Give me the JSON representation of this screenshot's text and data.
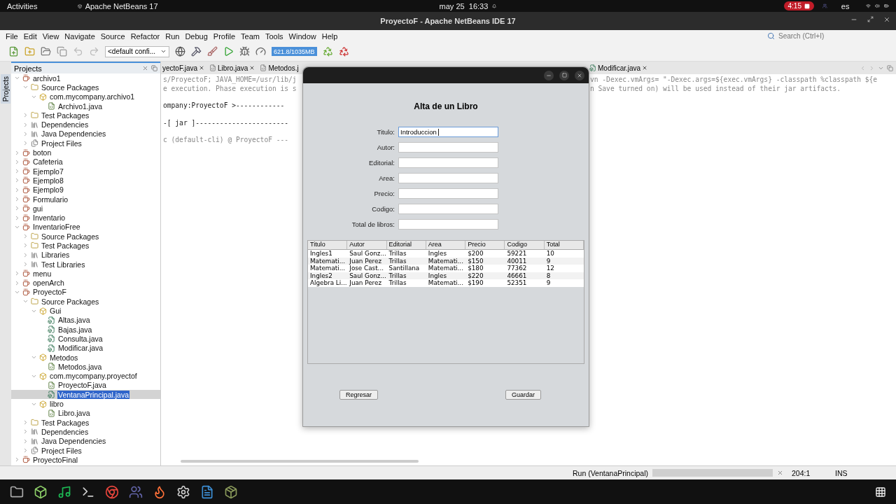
{
  "top_bar": {
    "activities": "Activities",
    "app": "Apache NetBeans 17",
    "clock": "may 25  16:33",
    "recording": "4:15",
    "language": "es"
  },
  "window": {
    "title": "ProyectoF - Apache NetBeans IDE 17"
  },
  "menu": [
    "File",
    "Edit",
    "View",
    "Navigate",
    "Source",
    "Refactor",
    "Run",
    "Debug",
    "Profile",
    "Team",
    "Tools",
    "Window",
    "Help"
  ],
  "search": {
    "placeholder": "Search (Ctrl+I)"
  },
  "toolbar": {
    "configuration": "<default confi...",
    "memory": "621.8/1035MB"
  },
  "side_tab": "Projects",
  "projects": {
    "title": "Projects",
    "tree": [
      {
        "label": "archivo1",
        "kind": "project",
        "expanded": true,
        "selected": false,
        "children": [
          {
            "label": "Source Packages",
            "kind": "sources",
            "expanded": true,
            "selected": false,
            "children": [
              {
                "label": "com.mycompany.archivo1",
                "kind": "package",
                "expanded": true,
                "selected": false,
                "children": [
                  {
                    "label": "Archivo1.java",
                    "kind": "file",
                    "selected": false
                  }
                ]
              }
            ]
          },
          {
            "label": "Test Packages",
            "kind": "sources",
            "expanded": false,
            "selected": false
          },
          {
            "label": "Dependencies",
            "kind": "library",
            "expanded": false,
            "selected": false
          },
          {
            "label": "Java Dependencies",
            "kind": "library",
            "expanded": false,
            "selected": false
          },
          {
            "label": "Project Files",
            "kind": "files",
            "expanded": false,
            "selected": false
          }
        ]
      },
      {
        "label": "boton",
        "kind": "project",
        "expanded": false,
        "selected": false
      },
      {
        "label": "Cafeteria",
        "kind": "project",
        "expanded": false,
        "selected": false
      },
      {
        "label": "Ejemplo7",
        "kind": "project",
        "expanded": false,
        "selected": false
      },
      {
        "label": "Ejemplo8",
        "kind": "project",
        "expanded": false,
        "selected": false
      },
      {
        "label": "Ejemplo9",
        "kind": "project",
        "expanded": false,
        "selected": false
      },
      {
        "label": "Formulario",
        "kind": "project",
        "expanded": false,
        "selected": false
      },
      {
        "label": "gui",
        "kind": "project",
        "expanded": false,
        "selected": false
      },
      {
        "label": "Inventario",
        "kind": "project",
        "expanded": false,
        "selected": false
      },
      {
        "label": "InventarioFree",
        "kind": "project",
        "expanded": true,
        "selected": false,
        "children": [
          {
            "label": "Source Packages",
            "kind": "sources",
            "expanded": false,
            "selected": false
          },
          {
            "label": "Test Packages",
            "kind": "sources",
            "expanded": false,
            "selected": false
          },
          {
            "label": "Libraries",
            "kind": "library",
            "expanded": false,
            "selected": false
          },
          {
            "label": "Test Libraries",
            "kind": "library",
            "expanded": false,
            "selected": false
          }
        ]
      },
      {
        "label": "menu",
        "kind": "project",
        "expanded": false,
        "selected": false
      },
      {
        "label": "openArch",
        "kind": "project",
        "expanded": false,
        "selected": false
      },
      {
        "label": "ProyectoF",
        "kind": "project",
        "expanded": true,
        "selected": false,
        "children": [
          {
            "label": "Source Packages",
            "kind": "sources",
            "expanded": true,
            "selected": false,
            "children": [
              {
                "label": "Gui",
                "kind": "package",
                "expanded": true,
                "selected": false,
                "children": [
                  {
                    "label": "Altas.java",
                    "kind": "form",
                    "selected": false
                  },
                  {
                    "label": "Bajas.java",
                    "kind": "form",
                    "selected": false
                  },
                  {
                    "label": "Consulta.java",
                    "kind": "form",
                    "selected": false
                  },
                  {
                    "label": "Modificar.java",
                    "kind": "form",
                    "selected": false
                  }
                ]
              },
              {
                "label": "Metodos",
                "kind": "package",
                "expanded": true,
                "selected": false,
                "children": [
                  {
                    "label": "Metodos.java",
                    "kind": "file",
                    "selected": false
                  }
                ]
              },
              {
                "label": "com.mycompany.proyectof",
                "kind": "package",
                "expanded": true,
                "selected": false,
                "children": [
                  {
                    "label": "ProyectoF.java",
                    "kind": "file",
                    "selected": false
                  },
                  {
                    "label": "VentanaPrincipal.java",
                    "kind": "form",
                    "selected": true
                  }
                ]
              },
              {
                "label": "libro",
                "kind": "package",
                "expanded": true,
                "selected": false,
                "children": [
                  {
                    "label": "Libro.java",
                    "kind": "file",
                    "selected": false
                  }
                ]
              }
            ]
          },
          {
            "label": "Test Packages",
            "kind": "sources",
            "expanded": false,
            "selected": false
          },
          {
            "label": "Dependencies",
            "kind": "library",
            "expanded": false,
            "selected": false
          },
          {
            "label": "Java Dependencies",
            "kind": "library",
            "expanded": false,
            "selected": false
          },
          {
            "label": "Project Files",
            "kind": "files",
            "expanded": false,
            "selected": false
          }
        ]
      },
      {
        "label": "ProyectoFinal",
        "kind": "project",
        "expanded": false,
        "selected": false
      }
    ]
  },
  "editor": {
    "tabs_left": [
      {
        "label": "yectoF.java",
        "selected": false
      },
      {
        "label": "Libro.java",
        "selected": false
      },
      {
        "label": "Metodos.j",
        "selected": false
      }
    ],
    "tabs_right": [
      {
        "label": "Modificar.java",
        "selected": false
      }
    ],
    "output": [
      [
        {
          "left": "s/ProyectoF; JAVA_HOME=/usr/lib/j",
          "right": "vn -Dexec.vmArgs= \"-Dexec.args=${exec.vmArgs} -classpath %classpath ${e",
          "kind": "muted"
        },
        {
          "left": "e execution. Phase execution is s",
          "right": "n Save turned on) will be used instead of their jar artifacts.",
          "kind": "muted"
        }
      ],
      [
        {
          "left": "ompany:ProyectoF >------------",
          "kind": "normal"
        }
      ],
      [
        {
          "left": "-[ jar ]-----------------------",
          "kind": "normal"
        }
      ],
      [
        {
          "left": "c (default-cli) @ ProyectoF ---",
          "kind": "muted"
        }
      ]
    ]
  },
  "status_bar": {
    "task": "Run (VentanaPrincipal)",
    "progress": {
      "level": 1
    },
    "position": "204:1",
    "mode": "INS"
  },
  "dialog": {
    "heading": "Alta de un Libro",
    "fields": [
      {
        "label": "Titulo:",
        "value": "Introduccion",
        "focused": true
      },
      {
        "label": "Autor:",
        "focused": false
      },
      {
        "label": "Editorial:",
        "focused": false
      },
      {
        "label": "Area:",
        "focused": false
      },
      {
        "label": "Precio:",
        "focused": false
      },
      {
        "label": "Codigo:",
        "focused": false
      },
      {
        "label": "Total de libros:",
        "focused": false
      }
    ],
    "table": {
      "columns": [
        "Titulo",
        "Autor",
        "Editorial",
        "Area",
        "Precio",
        "Codigo",
        "Total"
      ],
      "rows": [
        [
          "Ingles1",
          "Saul Gonz...",
          "Trillas",
          "Ingles",
          "$200",
          "59221",
          "10"
        ],
        [
          "Matemati...",
          "Juan Perez",
          "Trillas",
          "Matemati...",
          "$150",
          "40011",
          "9"
        ],
        [
          "Matemati...",
          "Jose Cast...",
          "Santillana",
          "Matemati...",
          "$180",
          "77362",
          "12"
        ],
        [
          "Ingles2",
          "Saul Gonz...",
          "Trillas",
          "Ingles",
          "$220",
          "46661",
          "8"
        ],
        [
          "Algebra Li...",
          "Juan Perez",
          "Trillas",
          "Matemati...",
          "$190",
          "52351",
          "9"
        ]
      ]
    },
    "buttons": [
      "Regresar",
      "Guardar"
    ]
  }
}
